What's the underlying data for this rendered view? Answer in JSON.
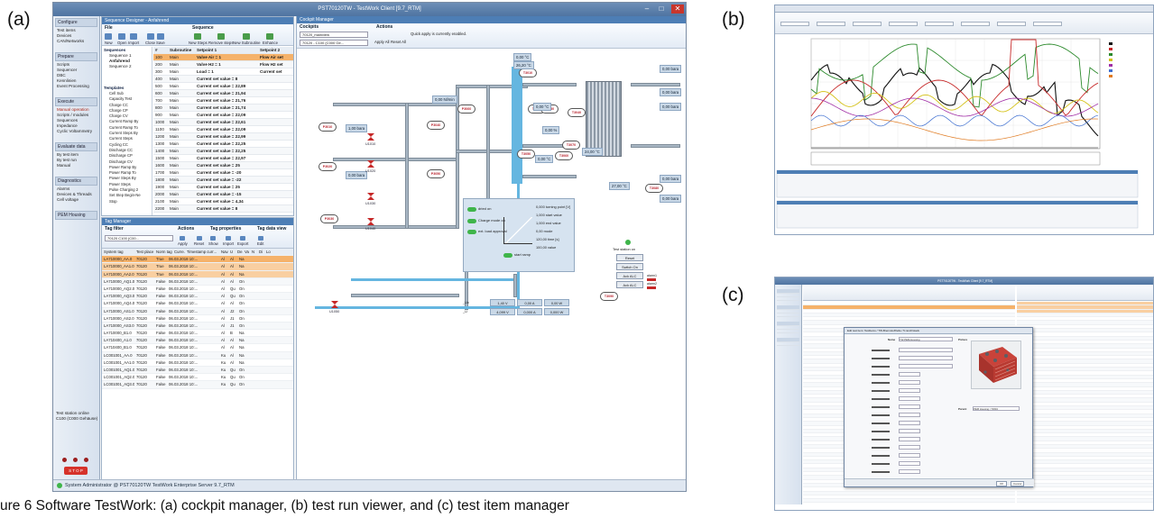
{
  "figure": {
    "label_a": "(a)",
    "label_b": "(b)",
    "label_c": "(c)",
    "caption": "ure 6   Software TestWork: (a) cockpit manager, (b) test run viewer, and (c) test item manager"
  },
  "panel_a": {
    "window_title": "PST70120TW - TestWork Client [9.7_RTM]",
    "nav": {
      "groups": [
        {
          "title": "Configure",
          "items": [
            "Test items",
            "Devices",
            "CAN/Networks"
          ]
        },
        {
          "title": "Prepare",
          "items": [
            "Scripts",
            "Sequencer",
            "DBC",
            "Kennlinien",
            "Event Processing"
          ]
        },
        {
          "title": "Execute",
          "items": [
            "Manual operation",
            "Scripts / modules",
            "Sequences",
            "Impedance",
            "Cyclic Voltammetry"
          ]
        },
        {
          "title": "Evaluate data",
          "items": [
            "By test item",
            "By test run",
            "Manual"
          ]
        },
        {
          "title": "Diagnostics",
          "items": [
            "Alarms",
            "Devices & Threads",
            "Cell voltage"
          ]
        },
        {
          "title": "PEM Housing",
          "items": []
        }
      ],
      "station_status": "Test station online",
      "station_name": "C100 (C000 Gehäuse)",
      "stop_label": "S T O P"
    },
    "sequence_designer": {
      "title": "Sequence Designer - Anfahrend",
      "ribbon_file": "File",
      "ribbon_sequence": "Sequence",
      "buttons": [
        "New",
        "Open",
        "Import",
        "Close",
        "Save",
        "New Steps",
        "Remove steps",
        "New Subroutine",
        "Enhance"
      ],
      "tree_sequences": "Sequences",
      "tree_items": [
        "Sequence 1",
        "Anfahrend",
        "Sequence 2"
      ],
      "tree_templates": "Templates",
      "template_items": [
        "Cell Sub",
        "Capacity Test",
        "Charge CC",
        "Charge CP",
        "Charge CV",
        "Current Ramp By",
        "Current Ramp To",
        "Current Steps By",
        "Current Steps",
        "Cycling CC",
        "Discharge CC",
        "Discharge CP",
        "Discharge CV",
        "Power Ramp By",
        "Power Ramp To",
        "Power Steps By",
        "Power Steps",
        "Pulse Charging 2",
        "Set Step Begin-Ne",
        "Stop"
      ],
      "columns": [
        "#",
        "Subroutine",
        "Setpoint 1",
        "Setpoint 2"
      ],
      "rows": [
        [
          "100",
          "Main",
          "Valve Air = 1",
          "Flow Air set"
        ],
        [
          "200",
          "Main",
          "Valve H2 = 1",
          "Flow H2 set"
        ],
        [
          "300",
          "Main",
          "Load = 1",
          "Current set"
        ],
        [
          "400",
          "Main",
          "Current set value = 8",
          ""
        ],
        [
          "500",
          "Main",
          "Current set value = 22,89",
          ""
        ],
        [
          "600",
          "Main",
          "Current set value = 21,94",
          ""
        ],
        [
          "700",
          "Main",
          "Current set value = 21,76",
          ""
        ],
        [
          "800",
          "Main",
          "Current set value = 21,74",
          ""
        ],
        [
          "900",
          "Main",
          "Current set value = 22,09",
          ""
        ],
        [
          "1000",
          "Main",
          "Current set value = 22,61",
          ""
        ],
        [
          "1100",
          "Main",
          "Current set value = 22,09",
          ""
        ],
        [
          "1200",
          "Main",
          "Current set value = 22,99",
          ""
        ],
        [
          "1300",
          "Main",
          "Current set value = 22,25",
          ""
        ],
        [
          "1400",
          "Main",
          "Current set value = 22,25",
          ""
        ],
        [
          "1500",
          "Main",
          "Current set value = 22,97",
          ""
        ],
        [
          "1600",
          "Main",
          "Current set value = 25",
          ""
        ],
        [
          "1700",
          "Main",
          "Current set value = -20",
          ""
        ],
        [
          "1800",
          "Main",
          "Current set value = -22",
          ""
        ],
        [
          "1900",
          "Main",
          "Current set value = 25",
          ""
        ],
        [
          "2000",
          "Main",
          "Current set value = -15",
          ""
        ],
        [
          "2100",
          "Main",
          "Current set value = 4,34",
          ""
        ],
        [
          "2200",
          "Main",
          "Current set value = 8",
          ""
        ]
      ]
    },
    "tag_manager": {
      "title": "Tag Manager",
      "filter_label": "Tag filter",
      "filter_value": "70120 C100 (C00...",
      "actions_label": "Actions",
      "tag_properties_label": "Tag properties",
      "tag_data_label": "Tag data view",
      "buttons": [
        "Apply",
        "Reset",
        "Show",
        "Import",
        "Export",
        "Edit"
      ],
      "columns": [
        "System tag",
        "Test place",
        "Norm tag",
        "Curre...",
        "Timestamp curr...",
        "Nav...",
        "U",
        "De...",
        "Va",
        "N",
        "Di",
        "Lo"
      ],
      "rows": [
        [
          "LA710000_AA.0",
          "70120",
          "True",
          "06.03.2018 10:...",
          "Al",
          "Al",
          "Na"
        ],
        [
          "LA710000_AA1.0",
          "70120",
          "True",
          "06.03.2018 10:...",
          "Al",
          "Al",
          "Na"
        ],
        [
          "LA710000_AA2.0",
          "70120",
          "True",
          "06.03.2018 10:...",
          "Al",
          "Al",
          "Na"
        ],
        [
          "LA710000_AQ1.0",
          "70120",
          "False",
          "06.03.2018 10:...",
          "Al",
          "Al",
          "On"
        ],
        [
          "LA710000_AQ2.0",
          "70120",
          "False",
          "06.03.2018 10:...",
          "Al",
          "Qu",
          "On"
        ],
        [
          "LA710000_AQ3.0",
          "70120",
          "False",
          "06.03.2018 10:...",
          "Al",
          "Qu",
          "On"
        ],
        [
          "LA710000_AQ4.0",
          "70120",
          "False",
          "06.03.2018 10:...",
          "Al",
          "Al",
          "On"
        ],
        [
          "LA710000_AS1.0",
          "70120",
          "False",
          "06.03.2018 10:...",
          "Al",
          "J2",
          "On"
        ],
        [
          "LA710000_AS2.0",
          "70120",
          "False",
          "06.03.2018 10:...",
          "Al",
          "J1",
          "On"
        ],
        [
          "LA710000_AS3.0",
          "70120",
          "False",
          "06.03.2018 10:...",
          "Al",
          "J1",
          "On"
        ],
        [
          "LA710000_B1.0",
          "70120",
          "False",
          "06.03.2018 10:...",
          "Al",
          "B",
          "Na"
        ],
        [
          "LA710400_A1.0",
          "70120",
          "False",
          "06.03.2018 10:...",
          "Al",
          "Al",
          "Na"
        ],
        [
          "LA710400_B1.0",
          "70120",
          "False",
          "06.03.2018 10:...",
          "Al",
          "Al",
          "Na"
        ],
        [
          "LC001001_AA.0",
          "70120",
          "False",
          "06.03.2018 10:...",
          "Ku",
          "Al",
          "Na"
        ],
        [
          "LC001001_AA1.0",
          "70120",
          "False",
          "06.03.2018 10:...",
          "Ku",
          "Al",
          "Na"
        ],
        [
          "LC001001_AQ1.0",
          "70120",
          "False",
          "06.03.2018 10:...",
          "Ku",
          "Qu",
          "On"
        ],
        [
          "LC001001_AQ2.0",
          "70120",
          "False",
          "06.03.2018 10:...",
          "Ku",
          "Qu",
          "On"
        ],
        [
          "LC001001_AQ3.0",
          "70120",
          "False",
          "06.03.2018 10:...",
          "Ku",
          "Qu",
          "On"
        ]
      ]
    },
    "cockpit": {
      "title": "Cockpit Manager",
      "cockpits_label": "Cockpits",
      "cockpit_value": "70120_mainview",
      "cockpit_sub": "70120 - C100 (C000 Ge...",
      "actions_label": "Actions",
      "apply_all": "Apply All",
      "reset_all": "Reset All",
      "quick_apply": "Quick apply is currently enabled.",
      "sensors": [
        "P3010",
        "P3020",
        "P3030",
        "P3040",
        "P3050",
        "P3060",
        "P3070",
        "T3010",
        "T3020",
        "T3030",
        "T3040",
        "T3050",
        "T3060",
        "T3070",
        "T3080",
        "T3090"
      ],
      "values": [
        "0,00 °C",
        "26,20 °C",
        "0,00 bara",
        "0,00 bara",
        "0,00 Nl/min",
        "0,00 °C",
        "0,00 %",
        "0,00 bara",
        "1,00 bara",
        "0,00 bara",
        "0,00 °C",
        "24,00 °C",
        "0,00 bara",
        "0,00 bara",
        "27,00 °C"
      ],
      "valve_labels": [
        "U1010",
        "U1020",
        "U1030",
        "U1040",
        "U1050"
      ],
      "control": {
        "dried_on": "dried on",
        "charge_mode_on": "Charge mode on",
        "ext_load_approval": "ext. load approval",
        "start_ramp": "start ramp",
        "turning_point": "0,000 turning point [V]",
        "start_value": "1,000 start value",
        "end_value": "1,000 end value",
        "mode": "0,00 mode",
        "time": "120,00 time [s]",
        "final": "100,00 value"
      },
      "meter_rows": [
        [
          "_Uc",
          "1,40 V",
          "0,00 A",
          "0,00 W"
        ],
        [
          "_U",
          "4,099 V",
          "0,000 A",
          "0,000 W"
        ]
      ],
      "station_panel": {
        "title": "Test station on",
        "buttons": [
          "Reset",
          "Switch On",
          "Ack ALC",
          "Ack ALC"
        ],
        "alarms": [
          "alarm1",
          "alarm2"
        ]
      }
    },
    "status_bar": "System Administrator @ PST70120TW    TestWork Enterprise Server 9.7_RTM"
  },
  "panel_c": {
    "window_title": "PST70120TW - TestWork Client [9.7_RTM]",
    "dialog_title": "Edit test item: TestItems / TW-Brennstoffzelle / 5 ranch/stack",
    "name_label": "Name",
    "name_value": "TW-PEM-Housing",
    "picture_label": "Picture",
    "parent_label": "Parent",
    "parent_value": "PEM Housing / TW04",
    "save_label": "OK",
    "cancel_label": "Cancel"
  },
  "colors": {
    "title_blue": "#4f74a1",
    "pane_header": "#4d7eb5",
    "highlight_orange": "#f5b26a",
    "alarm_red": "#c62828",
    "water_blue": "#65b6e0"
  }
}
